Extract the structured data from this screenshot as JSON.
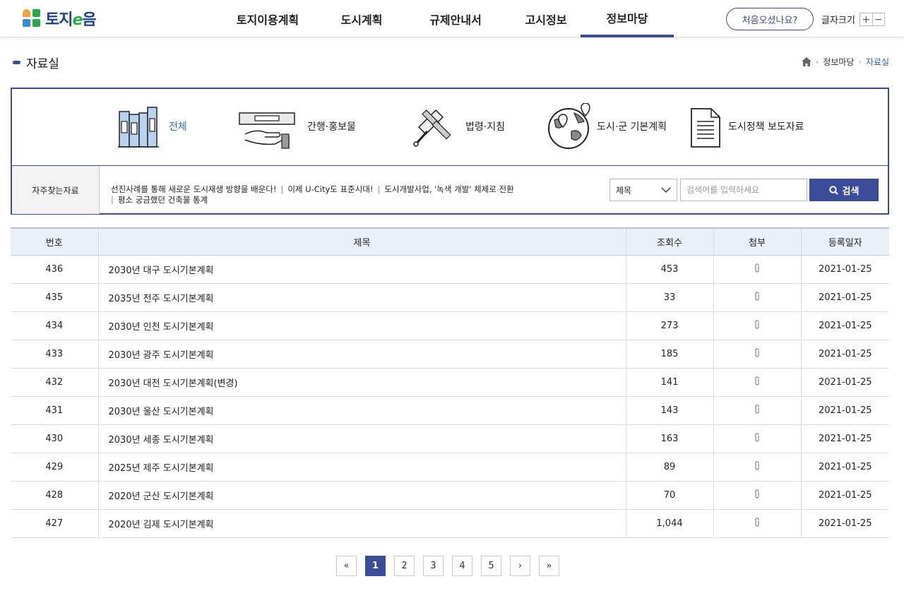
{
  "header": {
    "logo_text": "토지",
    "logo_e": "e",
    "logo_suffix": "음",
    "nav": [
      "토지이용계획",
      "도시계획",
      "규제안내서",
      "고시정보",
      "정보마당"
    ],
    "first_visit": "처음오셨나요?",
    "font_size_label": "글자크기",
    "font_plus": "+",
    "font_minus": "−"
  },
  "page": {
    "title": "자료실",
    "breadcrumb": [
      "정보마당",
      "자료실"
    ]
  },
  "categories": [
    {
      "label": "전체",
      "icon": "books-icon"
    },
    {
      "label": "간행·홍보물",
      "icon": "hand-brochure-icon"
    },
    {
      "label": "법령·지침",
      "icon": "gavel-icon"
    },
    {
      "label": "도시·군 기본계획",
      "icon": "globe-pin-icon"
    },
    {
      "label": "도시정책 보도자료",
      "icon": "document-icon"
    }
  ],
  "frequent": {
    "label": "자주찾는자료",
    "links": [
      "선진사례를 통해 새로운 도시재생 방향을 배운다!",
      "이제 U-City도 표준시대!",
      "도시개발사업, '녹색 개발' 체제로 전환",
      "평소 궁금했던 건축물 통계"
    ]
  },
  "search": {
    "select_value": "제목",
    "placeholder": "검색어를 입력하세요",
    "button": "검색"
  },
  "table": {
    "headers": [
      "번호",
      "제목",
      "조회수",
      "첨부",
      "등록일자"
    ],
    "rows": [
      {
        "no": "436",
        "title": "2030년 대구 도시기본계획",
        "views": "453",
        "date": "2021-01-25"
      },
      {
        "no": "435",
        "title": "2035년 전주 도시기본계획",
        "views": "33",
        "date": "2021-01-25"
      },
      {
        "no": "434",
        "title": "2030년 인천 도시기본계획",
        "views": "273",
        "date": "2021-01-25"
      },
      {
        "no": "433",
        "title": "2030년 광주 도시기본계획",
        "views": "185",
        "date": "2021-01-25"
      },
      {
        "no": "432",
        "title": "2030년 대전 도시기본계획(변경)",
        "views": "141",
        "date": "2021-01-25"
      },
      {
        "no": "431",
        "title": "2030년 울산 도시기본계획",
        "views": "143",
        "date": "2021-01-25"
      },
      {
        "no": "430",
        "title": "2030년 세종 도시기본계획",
        "views": "163",
        "date": "2021-01-25"
      },
      {
        "no": "429",
        "title": "2025년 제주 도시기본계획",
        "views": "89",
        "date": "2021-01-25"
      },
      {
        "no": "428",
        "title": "2020년 군산 도시기본계획",
        "views": "70",
        "date": "2021-01-25"
      },
      {
        "no": "427",
        "title": "2020년 김제 도시기본계획",
        "views": "1,044",
        "date": "2021-01-25"
      }
    ]
  },
  "pagination": {
    "first": "«",
    "pages": [
      "1",
      "2",
      "3",
      "4",
      "5"
    ],
    "next": "›",
    "last": "»",
    "current": "1"
  },
  "colors": {
    "accent": "#3b4c9a",
    "active_link": "#2a6dc4"
  }
}
